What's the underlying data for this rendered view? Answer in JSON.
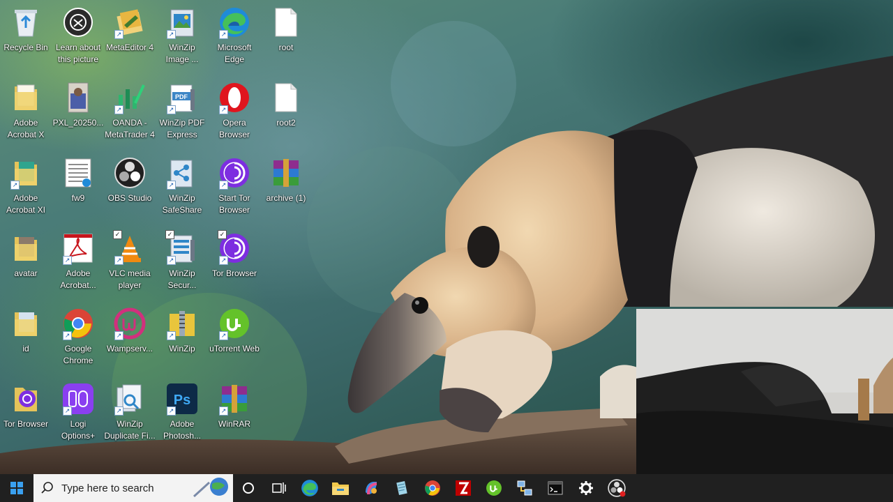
{
  "desktop": {
    "icons": [
      {
        "id": "recycle-bin",
        "label": "Recycle Bin",
        "icon": "recycle-bin-icon",
        "shortcut": false
      },
      {
        "id": "learn-about",
        "label": "Learn about this picture",
        "icon": "camera-icon",
        "shortcut": false
      },
      {
        "id": "metaeditor",
        "label": "MetaEditor 4",
        "icon": "metaeditor-icon",
        "shortcut": true
      },
      {
        "id": "winzip-image",
        "label": "WinZip Image ...",
        "icon": "winzip-image-icon",
        "shortcut": true
      },
      {
        "id": "edge",
        "label": "Microsoft Edge",
        "icon": "edge-icon",
        "shortcut": true
      },
      {
        "id": "root",
        "label": "root",
        "icon": "file-icon",
        "shortcut": false
      },
      {
        "id": "acrobat-x",
        "label": "Adobe Acrobat X",
        "icon": "folder-icon",
        "shortcut": false
      },
      {
        "id": "pxl",
        "label": "PXL_20250...",
        "icon": "photo-icon",
        "shortcut": false
      },
      {
        "id": "oanda",
        "label": "OANDA - MetaTrader 4",
        "icon": "metatrader-icon",
        "shortcut": true
      },
      {
        "id": "winzip-pdf",
        "label": "WinZip PDF Express",
        "icon": "pdf-icon",
        "shortcut": true
      },
      {
        "id": "opera",
        "label": "Opera Browser",
        "icon": "opera-icon",
        "shortcut": true
      },
      {
        "id": "root2",
        "label": "root2",
        "icon": "file-icon",
        "shortcut": false
      },
      {
        "id": "acrobat-xi",
        "label": "Adobe Acrobat XI",
        "icon": "folder-icon",
        "shortcut": false
      },
      {
        "id": "fw9",
        "label": "fw9",
        "icon": "document-icon",
        "shortcut": false
      },
      {
        "id": "obs",
        "label": "OBS Studio",
        "icon": "obs-icon",
        "shortcut": false
      },
      {
        "id": "winzip-safeshare",
        "label": "WinZip SafeShare",
        "icon": "safeshare-icon",
        "shortcut": true
      },
      {
        "id": "start-tor",
        "label": "Start Tor Browser",
        "icon": "tor-icon",
        "shortcut": true
      },
      {
        "id": "archive",
        "label": "archive (1)",
        "icon": "winrar-icon",
        "shortcut": false
      },
      {
        "id": "avatar",
        "label": "avatar",
        "icon": "folder-icon",
        "shortcut": false
      },
      {
        "id": "adobe-acrobat",
        "label": "Adobe Acrobat...",
        "icon": "acrobat-icon",
        "shortcut": true
      },
      {
        "id": "vlc",
        "label": "VLC media player",
        "icon": "vlc-icon",
        "shortcut": true,
        "checked": true
      },
      {
        "id": "winzip-secure",
        "label": "WinZip Secur...",
        "icon": "winzip-secure-icon",
        "shortcut": true,
        "checked": true
      },
      {
        "id": "tor-browser-1",
        "label": "Tor Browser",
        "icon": "tor-icon",
        "shortcut": true,
        "checked": true
      },
      {
        "id": "id-folder",
        "label": "id",
        "icon": "folder-icon",
        "shortcut": false
      },
      {
        "id": "chrome",
        "label": "Google Chrome",
        "icon": "chrome-icon",
        "shortcut": true
      },
      {
        "id": "wamp",
        "label": "Wampserv...",
        "icon": "wamp-icon",
        "shortcut": true
      },
      {
        "id": "winzip",
        "label": "WinZip",
        "icon": "winzip-icon",
        "shortcut": true
      },
      {
        "id": "utorrent",
        "label": "uTorrent Web",
        "icon": "utorrent-icon",
        "shortcut": true
      },
      {
        "id": "tor-browser-2",
        "label": "Tor Browser",
        "icon": "tor-folder-icon",
        "shortcut": false
      },
      {
        "id": "logi",
        "label": "Logi Options+",
        "icon": "logi-icon",
        "shortcut": true
      },
      {
        "id": "winzip-dup",
        "label": "WinZip Duplicate Fi...",
        "icon": "winzip-duplicate-icon",
        "shortcut": true
      },
      {
        "id": "photoshop",
        "label": "Adobe Photosh...",
        "icon": "photoshop-icon",
        "shortcut": true
      },
      {
        "id": "winrar",
        "label": "WinRAR",
        "icon": "winrar-icon",
        "shortcut": true
      }
    ]
  },
  "taskbar": {
    "start_icon": "windows-start-icon",
    "search_placeholder": "Type here to search",
    "items": [
      {
        "name": "cortana",
        "icon": "cortana-icon"
      },
      {
        "name": "task-view",
        "icon": "task-view-icon"
      },
      {
        "name": "edge",
        "icon": "edge-icon"
      },
      {
        "name": "file-explorer",
        "icon": "folder-icon"
      },
      {
        "name": "copilot",
        "icon": "copilot-icon"
      },
      {
        "name": "notepad",
        "icon": "notepad-icon"
      },
      {
        "name": "chrome",
        "icon": "chrome-icon"
      },
      {
        "name": "filezilla",
        "icon": "filezilla-icon"
      },
      {
        "name": "utorrent",
        "icon": "utorrent-icon"
      },
      {
        "name": "network",
        "icon": "network-icon"
      },
      {
        "name": "terminal",
        "icon": "terminal-icon"
      },
      {
        "name": "settings",
        "icon": "gear-icon"
      },
      {
        "name": "obs",
        "icon": "obs-icon"
      }
    ]
  },
  "colors": {
    "taskbar": "#202020",
    "search_box": "#f3f3f3",
    "icon_label": "#ffffff"
  }
}
